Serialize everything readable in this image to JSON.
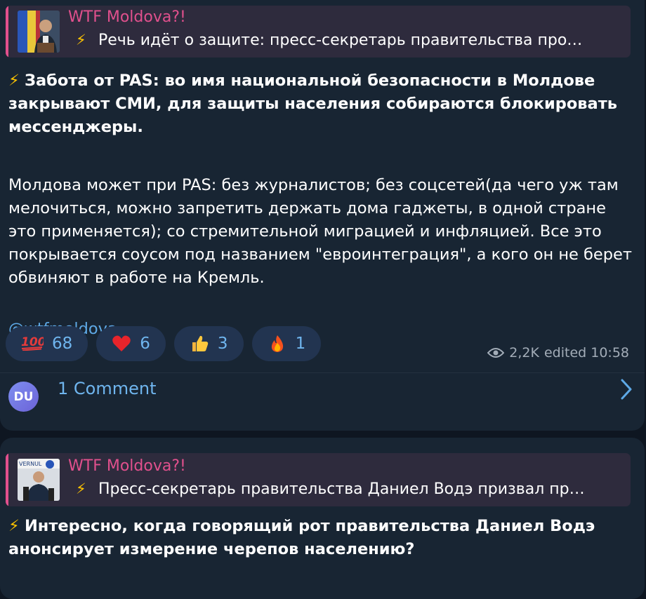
{
  "msg1": {
    "reply": {
      "channel": "WTF Moldova?!",
      "bolt": "⚡",
      "text": "Речь идёт о защите: пресс-секретарь правительства про…"
    },
    "bolt": "⚡",
    "headline": "Забота от PAS: во имя национальной безопасности в Молдове закрывают СМИ, для защиты населения собираются блокировать мессенджеры.",
    "paragraph": "Молдова может при PAS: без журналистов; без соцсетей(да чего уж там мелочиться, можно запретить держать дома гаджеты, в одной стране это применяется); со стремительной миграцией и инфляцией. Все это покрывается соусом под названием \"евроинтеграция\", а кого он не берет обвиняют в работе на Кремль.",
    "handle": "@wtfmoldova",
    "reactions": [
      {
        "emoji": "100",
        "count": "68"
      },
      {
        "emoji": "red-heart",
        "count": "6"
      },
      {
        "emoji": "thumbs-up",
        "count": "3"
      },
      {
        "emoji": "fire",
        "count": "1"
      }
    ],
    "meta": {
      "views": "2,2K",
      "edited_time": "edited 10:58"
    },
    "comments": {
      "avatar_initials": "DU",
      "label": "1 Comment"
    }
  },
  "msg2": {
    "reply": {
      "channel": "WTF Moldova?!",
      "bolt": "⚡",
      "text": "Пресс-секретарь правительства Даниел Водэ призвал пр…",
      "thumb_caption": "VERNUL"
    },
    "bolt": "⚡",
    "headline": "Интересно, когда говорящий рот правительства Даниел Водэ анонсирует измерение черепов населению?"
  },
  "colors": {
    "background": "#0e1621",
    "bubble": "#182533",
    "accent_pink": "#e1508d",
    "link_blue": "#5ea9e6"
  }
}
